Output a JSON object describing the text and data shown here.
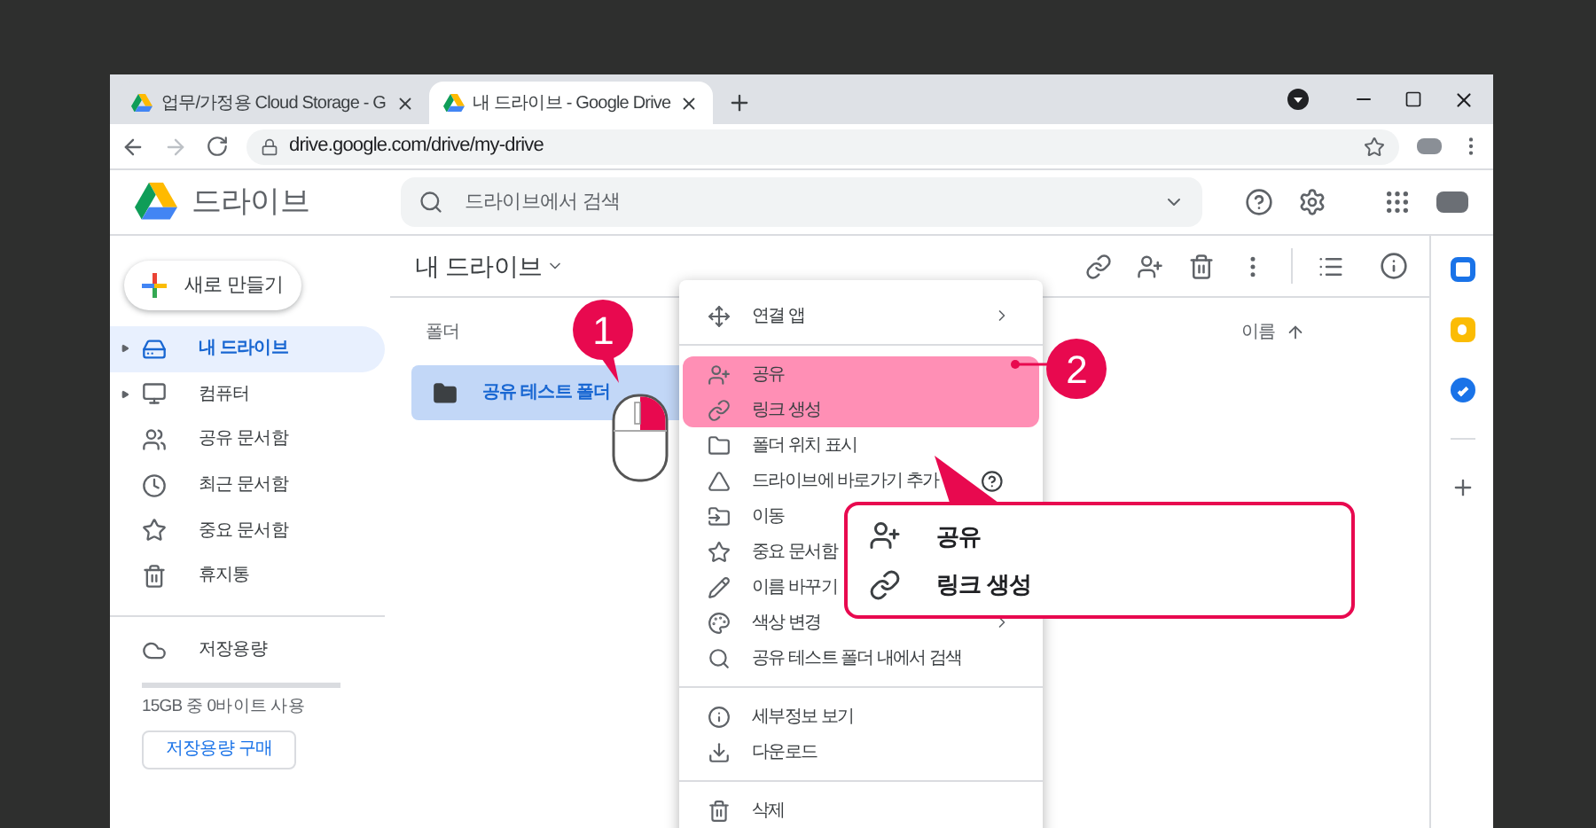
{
  "browser": {
    "tabs": [
      {
        "title": "업무/가정용 Cloud Storage - G",
        "selected": false
      },
      {
        "title": "내 드라이브 - Google Drive",
        "selected": true
      }
    ],
    "url": "drive.google.com/drive/my-drive"
  },
  "header": {
    "app_name": "드라이브",
    "search": {
      "placeholder": "드라이브에서 검색"
    }
  },
  "sidebar": {
    "new_button": "새로 만들기",
    "items": [
      {
        "label": "내 드라이브",
        "selected": true,
        "expandable": true
      },
      {
        "label": "컴퓨터",
        "selected": false,
        "expandable": true
      },
      {
        "label": "공유 문서함",
        "selected": false,
        "expandable": false
      },
      {
        "label": "최근 문서함",
        "selected": false,
        "expandable": false
      },
      {
        "label": "중요 문서함",
        "selected": false,
        "expandable": false
      },
      {
        "label": "휴지통",
        "selected": false,
        "expandable": false
      }
    ],
    "storage": {
      "label": "저장용량",
      "level": 0,
      "usage": "15GB 중 0바이트 사용",
      "buy_button": "저장용량 구매"
    }
  },
  "main": {
    "title": "내 드라이브",
    "section_label": "폴더",
    "sort_label": "이름",
    "folders": [
      {
        "name": "공유 테스트 폴더",
        "selected": true
      }
    ]
  },
  "context_menu": {
    "groups": [
      [
        {
          "label": "연결 앱",
          "submenu": true,
          "help": false,
          "highlighted": false
        }
      ],
      [
        {
          "label": "공유",
          "submenu": false,
          "help": false,
          "highlighted": true
        },
        {
          "label": "링크 생성",
          "submenu": false,
          "help": false,
          "highlighted": true
        },
        {
          "label": "폴더 위치 표시",
          "submenu": false,
          "help": false,
          "highlighted": false
        },
        {
          "label": "드라이브에 바로가기 추가",
          "submenu": false,
          "help": true,
          "highlighted": false
        },
        {
          "label": "이동",
          "submenu": false,
          "help": false,
          "highlighted": false
        },
        {
          "label": "중요 문서함",
          "submenu": false,
          "help": false,
          "highlighted": false
        },
        {
          "label": "이름 바꾸기",
          "submenu": false,
          "help": false,
          "highlighted": false
        },
        {
          "label": "색상 변경",
          "submenu": true,
          "help": false,
          "highlighted": false
        },
        {
          "label": "공유 테스트 폴더 내에서 검색",
          "submenu": false,
          "help": false,
          "highlighted": false
        }
      ],
      [
        {
          "label": "세부정보 보기",
          "submenu": false,
          "help": false,
          "highlighted": false
        },
        {
          "label": "다운로드",
          "submenu": false,
          "help": false,
          "highlighted": false
        }
      ],
      [
        {
          "label": "삭제",
          "submenu": false,
          "help": false,
          "highlighted": false
        }
      ]
    ]
  },
  "annotations": {
    "badges": [
      "1",
      "2"
    ],
    "callout": [
      {
        "label": "공유"
      },
      {
        "label": "링크 생성"
      }
    ]
  }
}
